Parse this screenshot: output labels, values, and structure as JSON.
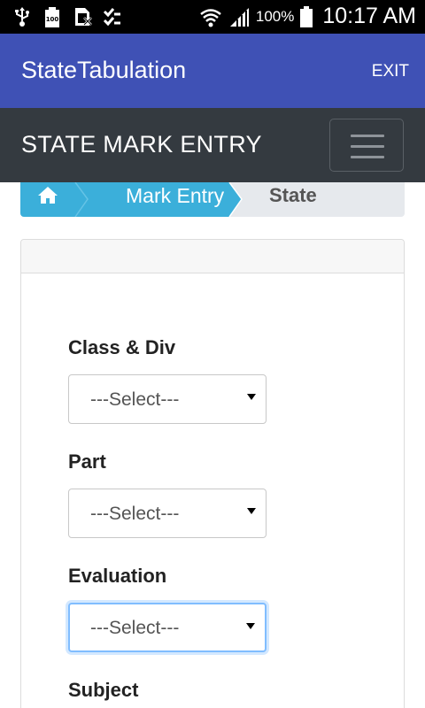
{
  "status_bar": {
    "battery_percent": "100%",
    "time": "10:17 AM",
    "left_icons": [
      "usb-icon",
      "battery-100-icon",
      "no-sim-icon",
      "checklist-icon"
    ],
    "right_icons": [
      "wifi-icon",
      "signal-icon",
      "battery-icon"
    ]
  },
  "app_bar": {
    "title": "StateTabulation",
    "exit_label": "EXIT",
    "color": "#3f51b5"
  },
  "navbar": {
    "heading": "STATE MARK ENTRY",
    "toggle_icon": "hamburger-menu-icon",
    "color": "#343a40"
  },
  "breadcrumb": {
    "home_icon": "home-icon",
    "items": [
      "Mark Entry",
      "State"
    ],
    "active_color": "#3bafda"
  },
  "form": {
    "fields": [
      {
        "label": "Class & Div",
        "value": "---Select---"
      },
      {
        "label": "Part",
        "value": "---Select---"
      },
      {
        "label": "Evaluation",
        "value": "---Select---"
      },
      {
        "label": "Subject"
      }
    ]
  }
}
